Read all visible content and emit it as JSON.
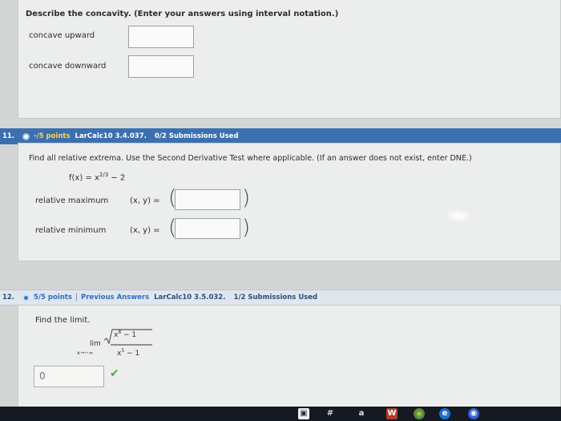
{
  "concavity": {
    "prompt": "Describe the concavity. (Enter your answers using interval notation.)",
    "concave_up_label": "concave upward",
    "concave_down_label": "concave downward"
  },
  "q11": {
    "number": "11.",
    "points": "-/5 points",
    "reference": "LarCalc10 3.4.037.",
    "submissions": "0/2 Submissions Used",
    "prompt": "Find all relative extrema. Use the Second Derivative Test where applicable. (If an answer does not exist, enter DNE.)",
    "function_lhs": "f(x) = x",
    "function_exp": "2/3",
    "function_rhs": " − 2",
    "rel_max_label": "relative maximum",
    "rel_min_label": "relative minimum",
    "xy_label": "(x, y) =",
    "paren_open": "(",
    "paren_close": ")"
  },
  "q12": {
    "number": "12.",
    "points": "5/5 points",
    "separator": "|",
    "previous_answers": "Previous Answers",
    "reference": "LarCalc10 3.5.032.",
    "submissions": "1/2 Submissions Used",
    "prompt": "Find the limit.",
    "lim_text": "lim",
    "lim_sub": "x→−∞",
    "numerator_radicand": "x",
    "numerator_exp": "8",
    "numerator_rest": " − 1",
    "denominator_base": "x",
    "denominator_exp": "5",
    "denominator_rest": " − 1",
    "answer_value": "0"
  },
  "taskbar": {
    "icon_store": "#",
    "icon_a": "a"
  },
  "colors": {
    "header_active": "#3b6fb0",
    "header_done": "#dfe6ee",
    "check_green": "#52a64b"
  }
}
